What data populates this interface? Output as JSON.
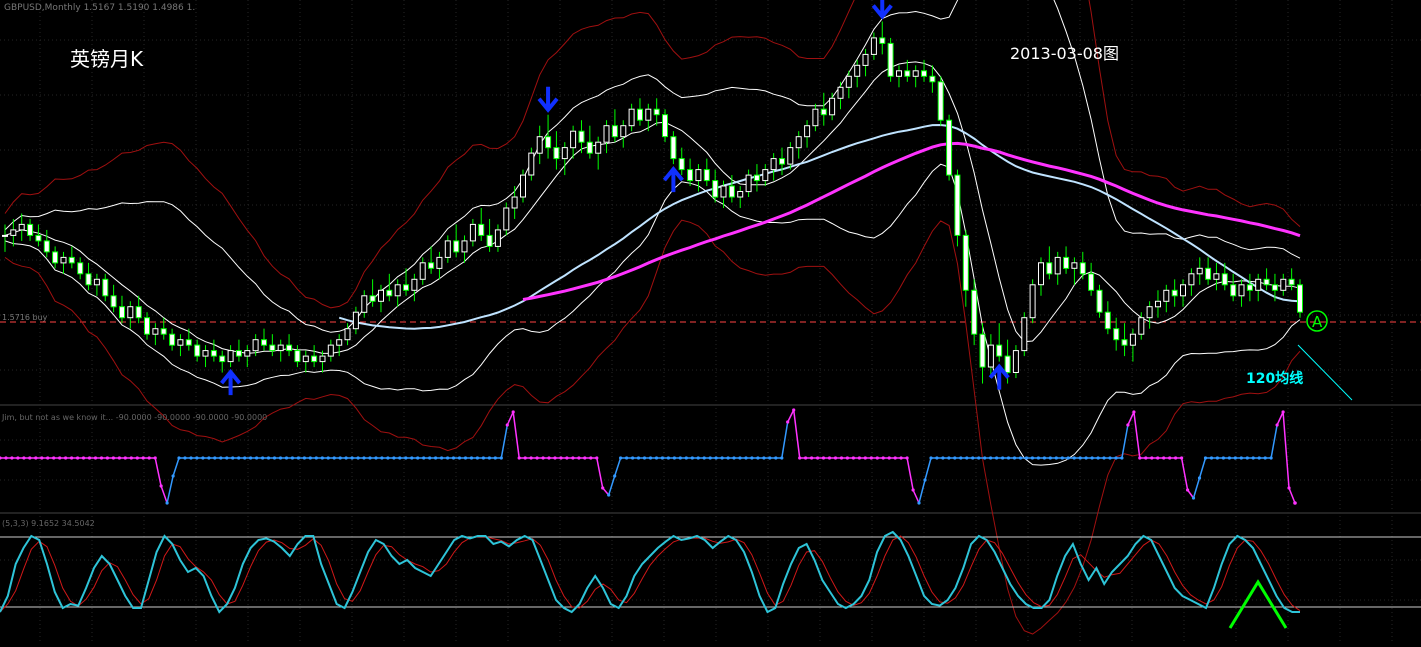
{
  "header": {
    "symbol_line": "GBPUSD,Monthly  1.5167 1.5190 1.4986 1.",
    "title": "英镑月K",
    "date_label": "2013-03-08图",
    "price_tag": "1.5716 buy",
    "ma_label": "120均线",
    "marker_letter": "A"
  },
  "colors": {
    "background": "#000000",
    "grid": "#2a2a2a",
    "bull_candle": "#ffffff",
    "bear_candle": "#00ff00",
    "band": "#ffffff",
    "outer_band": "#a01010",
    "ma_long": "#ff33ff",
    "ma_mid": "#bfe3ff",
    "arrow": "#1030ff",
    "stoch_main": "#2ec4d8",
    "stoch_signal": "#d01818",
    "ind_high": "#ff33ff",
    "ind_low": "#3399ff",
    "level_line": "#ff4444",
    "annotation": "#00ffff",
    "green_mark": "#00ff00"
  },
  "chart_data": [
    {
      "type": "candlestick",
      "name": "GBPUSD Monthly",
      "candles": [
        [
          0.6,
          0.62,
          0.57,
          0.6
        ],
        [
          0.6,
          0.63,
          0.58,
          0.61
        ],
        [
          0.61,
          0.64,
          0.59,
          0.62
        ],
        [
          0.62,
          0.63,
          0.59,
          0.6
        ],
        [
          0.6,
          0.62,
          0.58,
          0.59
        ],
        [
          0.59,
          0.61,
          0.56,
          0.57
        ],
        [
          0.57,
          0.58,
          0.54,
          0.55
        ],
        [
          0.55,
          0.57,
          0.53,
          0.56
        ],
        [
          0.56,
          0.58,
          0.54,
          0.55
        ],
        [
          0.55,
          0.56,
          0.52,
          0.53
        ],
        [
          0.53,
          0.55,
          0.5,
          0.51
        ],
        [
          0.51,
          0.53,
          0.49,
          0.52
        ],
        [
          0.52,
          0.53,
          0.48,
          0.49
        ],
        [
          0.49,
          0.51,
          0.46,
          0.47
        ],
        [
          0.47,
          0.49,
          0.44,
          0.45
        ],
        [
          0.45,
          0.48,
          0.43,
          0.47
        ],
        [
          0.47,
          0.49,
          0.44,
          0.45
        ],
        [
          0.45,
          0.46,
          0.41,
          0.42
        ],
        [
          0.42,
          0.44,
          0.4,
          0.43
        ],
        [
          0.43,
          0.45,
          0.41,
          0.42
        ],
        [
          0.42,
          0.43,
          0.39,
          0.4
        ],
        [
          0.4,
          0.42,
          0.38,
          0.41
        ],
        [
          0.41,
          0.43,
          0.39,
          0.4
        ],
        [
          0.4,
          0.41,
          0.37,
          0.38
        ],
        [
          0.38,
          0.4,
          0.36,
          0.39
        ],
        [
          0.39,
          0.41,
          0.37,
          0.38
        ],
        [
          0.38,
          0.39,
          0.35,
          0.37
        ],
        [
          0.37,
          0.4,
          0.36,
          0.39
        ],
        [
          0.39,
          0.41,
          0.37,
          0.38
        ],
        [
          0.38,
          0.4,
          0.36,
          0.39
        ],
        [
          0.39,
          0.42,
          0.38,
          0.41
        ],
        [
          0.41,
          0.43,
          0.39,
          0.4
        ],
        [
          0.4,
          0.42,
          0.38,
          0.39
        ],
        [
          0.39,
          0.41,
          0.37,
          0.4
        ],
        [
          0.4,
          0.42,
          0.38,
          0.39
        ],
        [
          0.39,
          0.4,
          0.36,
          0.37
        ],
        [
          0.37,
          0.39,
          0.35,
          0.38
        ],
        [
          0.38,
          0.4,
          0.36,
          0.37
        ],
        [
          0.37,
          0.39,
          0.35,
          0.38
        ],
        [
          0.38,
          0.41,
          0.37,
          0.4
        ],
        [
          0.4,
          0.42,
          0.38,
          0.41
        ],
        [
          0.41,
          0.44,
          0.4,
          0.43
        ],
        [
          0.43,
          0.47,
          0.42,
          0.46
        ],
        [
          0.46,
          0.5,
          0.45,
          0.49
        ],
        [
          0.49,
          0.52,
          0.47,
          0.48
        ],
        [
          0.48,
          0.51,
          0.46,
          0.5
        ],
        [
          0.5,
          0.53,
          0.48,
          0.49
        ],
        [
          0.49,
          0.52,
          0.47,
          0.51
        ],
        [
          0.51,
          0.54,
          0.49,
          0.5
        ],
        [
          0.5,
          0.53,
          0.48,
          0.52
        ],
        [
          0.52,
          0.56,
          0.51,
          0.55
        ],
        [
          0.55,
          0.58,
          0.53,
          0.54
        ],
        [
          0.54,
          0.57,
          0.52,
          0.56
        ],
        [
          0.56,
          0.6,
          0.55,
          0.59
        ],
        [
          0.59,
          0.62,
          0.56,
          0.57
        ],
        [
          0.57,
          0.6,
          0.55,
          0.59
        ],
        [
          0.59,
          0.63,
          0.58,
          0.62
        ],
        [
          0.62,
          0.65,
          0.59,
          0.6
        ],
        [
          0.6,
          0.63,
          0.57,
          0.58
        ],
        [
          0.58,
          0.62,
          0.57,
          0.61
        ],
        [
          0.61,
          0.66,
          0.6,
          0.65
        ],
        [
          0.65,
          0.69,
          0.63,
          0.67
        ],
        [
          0.67,
          0.72,
          0.66,
          0.71
        ],
        [
          0.71,
          0.76,
          0.7,
          0.75
        ],
        [
          0.75,
          0.8,
          0.73,
          0.78
        ],
        [
          0.78,
          0.82,
          0.74,
          0.76
        ],
        [
          0.76,
          0.79,
          0.72,
          0.74
        ],
        [
          0.74,
          0.77,
          0.71,
          0.76
        ],
        [
          0.76,
          0.8,
          0.74,
          0.79
        ],
        [
          0.79,
          0.81,
          0.75,
          0.77
        ],
        [
          0.77,
          0.8,
          0.74,
          0.75
        ],
        [
          0.75,
          0.78,
          0.72,
          0.77
        ],
        [
          0.77,
          0.81,
          0.75,
          0.8
        ],
        [
          0.8,
          0.83,
          0.77,
          0.78
        ],
        [
          0.78,
          0.81,
          0.76,
          0.8
        ],
        [
          0.8,
          0.84,
          0.79,
          0.83
        ],
        [
          0.83,
          0.85,
          0.8,
          0.81
        ],
        [
          0.81,
          0.84,
          0.79,
          0.83
        ],
        [
          0.83,
          0.85,
          0.8,
          0.82
        ],
        [
          0.82,
          0.83,
          0.77,
          0.78
        ],
        [
          0.78,
          0.79,
          0.73,
          0.74
        ],
        [
          0.74,
          0.76,
          0.71,
          0.72
        ],
        [
          0.72,
          0.74,
          0.69,
          0.7
        ],
        [
          0.7,
          0.73,
          0.68,
          0.72
        ],
        [
          0.72,
          0.74,
          0.69,
          0.7
        ],
        [
          0.7,
          0.72,
          0.66,
          0.67
        ],
        [
          0.67,
          0.7,
          0.65,
          0.69
        ],
        [
          0.69,
          0.71,
          0.66,
          0.67
        ],
        [
          0.67,
          0.69,
          0.65,
          0.68
        ],
        [
          0.68,
          0.72,
          0.67,
          0.71
        ],
        [
          0.71,
          0.73,
          0.68,
          0.7
        ],
        [
          0.7,
          0.73,
          0.69,
          0.72
        ],
        [
          0.72,
          0.75,
          0.7,
          0.74
        ],
        [
          0.74,
          0.76,
          0.71,
          0.73
        ],
        [
          0.73,
          0.77,
          0.72,
          0.76
        ],
        [
          0.76,
          0.79,
          0.74,
          0.78
        ],
        [
          0.78,
          0.81,
          0.76,
          0.8
        ],
        [
          0.8,
          0.84,
          0.79,
          0.83
        ],
        [
          0.83,
          0.86,
          0.8,
          0.82
        ],
        [
          0.82,
          0.86,
          0.81,
          0.85
        ],
        [
          0.85,
          0.88,
          0.83,
          0.87
        ],
        [
          0.87,
          0.9,
          0.85,
          0.89
        ],
        [
          0.89,
          0.92,
          0.87,
          0.91
        ],
        [
          0.91,
          0.94,
          0.89,
          0.93
        ],
        [
          0.93,
          0.97,
          0.92,
          0.96
        ],
        [
          0.96,
          0.99,
          0.93,
          0.95
        ],
        [
          0.95,
          0.96,
          0.88,
          0.89
        ],
        [
          0.89,
          0.91,
          0.87,
          0.9
        ],
        [
          0.9,
          0.92,
          0.88,
          0.89
        ],
        [
          0.89,
          0.91,
          0.87,
          0.9
        ],
        [
          0.9,
          0.92,
          0.88,
          0.89
        ],
        [
          0.89,
          0.91,
          0.86,
          0.88
        ],
        [
          0.88,
          0.89,
          0.8,
          0.81
        ],
        [
          0.81,
          0.82,
          0.7,
          0.71
        ],
        [
          0.71,
          0.72,
          0.58,
          0.6
        ],
        [
          0.6,
          0.61,
          0.47,
          0.5
        ],
        [
          0.5,
          0.52,
          0.4,
          0.42
        ],
        [
          0.42,
          0.44,
          0.33,
          0.36
        ],
        [
          0.36,
          0.42,
          0.34,
          0.4
        ],
        [
          0.4,
          0.44,
          0.37,
          0.38
        ],
        [
          0.38,
          0.41,
          0.33,
          0.35
        ],
        [
          0.35,
          0.4,
          0.34,
          0.39
        ],
        [
          0.39,
          0.46,
          0.38,
          0.45
        ],
        [
          0.45,
          0.52,
          0.44,
          0.51
        ],
        [
          0.51,
          0.56,
          0.49,
          0.55
        ],
        [
          0.55,
          0.58,
          0.52,
          0.53
        ],
        [
          0.53,
          0.57,
          0.51,
          0.56
        ],
        [
          0.56,
          0.58,
          0.53,
          0.54
        ],
        [
          0.54,
          0.56,
          0.51,
          0.55
        ],
        [
          0.55,
          0.57,
          0.52,
          0.53
        ],
        [
          0.53,
          0.55,
          0.49,
          0.5
        ],
        [
          0.5,
          0.51,
          0.45,
          0.46
        ],
        [
          0.46,
          0.48,
          0.42,
          0.43
        ],
        [
          0.43,
          0.45,
          0.39,
          0.41
        ],
        [
          0.41,
          0.44,
          0.38,
          0.4
        ],
        [
          0.4,
          0.43,
          0.37,
          0.42
        ],
        [
          0.42,
          0.46,
          0.41,
          0.45
        ],
        [
          0.45,
          0.48,
          0.43,
          0.47
        ],
        [
          0.47,
          0.5,
          0.45,
          0.48
        ],
        [
          0.48,
          0.51,
          0.46,
          0.5
        ],
        [
          0.5,
          0.52,
          0.47,
          0.49
        ],
        [
          0.49,
          0.52,
          0.47,
          0.51
        ],
        [
          0.51,
          0.54,
          0.49,
          0.53
        ],
        [
          0.53,
          0.56,
          0.51,
          0.54
        ],
        [
          0.54,
          0.56,
          0.51,
          0.52
        ],
        [
          0.52,
          0.55,
          0.5,
          0.53
        ],
        [
          0.53,
          0.55,
          0.5,
          0.51
        ],
        [
          0.51,
          0.53,
          0.48,
          0.49
        ],
        [
          0.49,
          0.52,
          0.47,
          0.51
        ],
        [
          0.51,
          0.53,
          0.48,
          0.5
        ],
        [
          0.5,
          0.53,
          0.48,
          0.52
        ],
        [
          0.52,
          0.54,
          0.5,
          0.51
        ],
        [
          0.51,
          0.53,
          0.48,
          0.5
        ],
        [
          0.5,
          0.53,
          0.49,
          0.52
        ],
        [
          0.52,
          0.54,
          0.5,
          0.51
        ],
        [
          0.51,
          0.52,
          0.45,
          0.46
        ]
      ],
      "overlays": [
        "Bollinger bands",
        "outer envelope",
        "120 MA (magenta)",
        "mid MA (light blue)"
      ],
      "ylim": [
        0.3,
        1.02
      ]
    },
    {
      "type": "line",
      "name": "Indicator (step oscillator)",
      "values": [
        -90,
        -90,
        -90,
        -90,
        -90,
        -90,
        -90,
        -90,
        -90,
        -90,
        -90,
        -90,
        -90,
        -90,
        -90,
        -90,
        -90,
        -90,
        -90,
        -90,
        -90,
        -90,
        -90,
        -90,
        -90,
        -90,
        -90,
        -90,
        -90,
        -90,
        -90,
        -90,
        -90,
        -90,
        -90,
        -90,
        -90,
        -90,
        -90,
        -90,
        -90,
        -90,
        -90,
        -90,
        -90,
        -90,
        -90,
        -90,
        -90,
        -90,
        -90,
        -90,
        -90,
        -90,
        -90,
        -90,
        -90,
        -90,
        -90,
        -90,
        -90,
        -90,
        -90,
        -90,
        -90,
        -90,
        -90,
        -90,
        -90,
        -90,
        -90,
        -90,
        -90,
        -90,
        -90,
        -90,
        -90,
        -90,
        -90,
        -90,
        -90,
        -90,
        -90,
        -90,
        -90,
        -90,
        -90,
        -90,
        -90,
        -90,
        -90,
        -90,
        -90,
        -90,
        -90,
        -90,
        -90,
        -90,
        -90,
        -90,
        -90,
        -90,
        -90,
        -90,
        -90,
        -90,
        -90,
        -90,
        -90,
        -90,
        -90,
        -90,
        -90,
        -90,
        -90,
        -90,
        -90,
        -90,
        -90,
        -90,
        -90,
        -90,
        -90,
        -90,
        -90,
        -90,
        -90,
        -90,
        -90,
        -90,
        -90,
        -90,
        -90,
        -90,
        -90,
        -90,
        -90,
        -90,
        -90,
        -90,
        -90,
        -90,
        -90,
        -90,
        -90,
        -90,
        -90,
        -90,
        -90,
        -90,
        -90,
        -90,
        -90,
        -90,
        -90,
        -90,
        -90,
        -90,
        -90,
        -90
      ],
      "label": "Jim, but not as we know it... -90.0000 -90.0000 -90.0000 -90.0000"
    },
    {
      "type": "line",
      "name": "Stochastic",
      "label": "(5,3,3) 9.1652 34.5042",
      "levels": [
        80,
        20
      ]
    }
  ]
}
